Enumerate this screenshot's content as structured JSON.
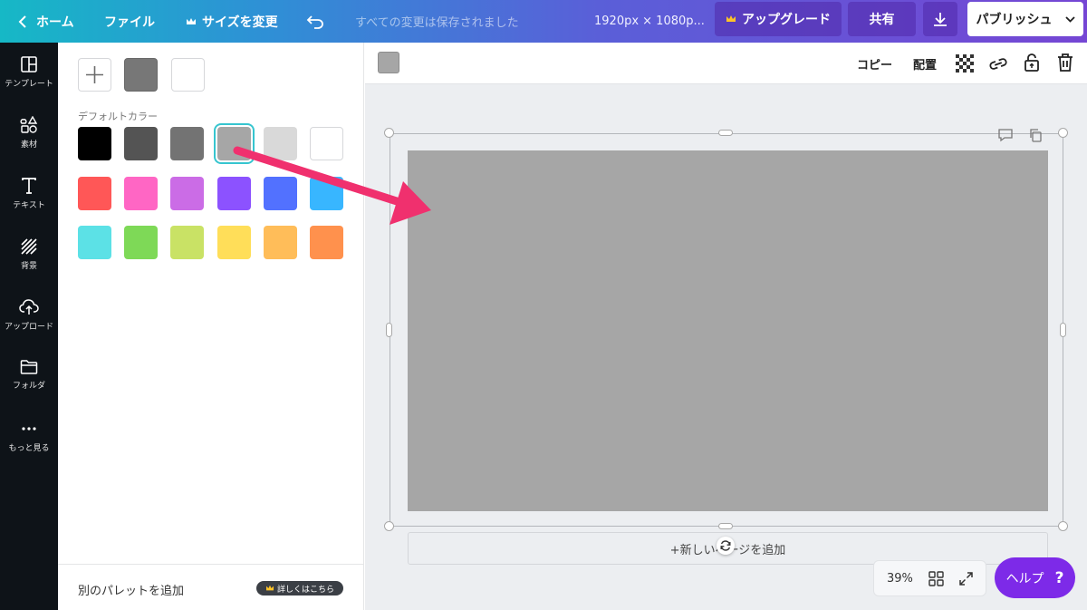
{
  "topbar": {
    "home_label": "ホーム",
    "file_label": "ファイル",
    "resize_label": "サイズを変更",
    "status_text": "すべての変更は保存されました",
    "dimensions_text": "1920px × 1080p...",
    "upgrade_label": "アップグレード",
    "share_label": "共有",
    "publish_label": "パブリッシュ"
  },
  "sidebar": {
    "items": [
      {
        "label": "テンプレート",
        "icon": "template-icon"
      },
      {
        "label": "素材",
        "icon": "elements-icon"
      },
      {
        "label": "テキスト",
        "icon": "text-icon"
      },
      {
        "label": "背景",
        "icon": "background-icon"
      },
      {
        "label": "アップロード",
        "icon": "upload-icon"
      },
      {
        "label": "フォルダ",
        "icon": "folder-icon"
      },
      {
        "label": "もっと見る",
        "icon": "more-icon"
      }
    ]
  },
  "panel": {
    "document_colors": [
      "#777777",
      "#ffffff"
    ],
    "default_colors_title": "デフォルトカラー",
    "default_colors": [
      "#000000",
      "#545454",
      "#737373",
      "#a6a6a6",
      "#d9d9d9",
      "#ffffff",
      "#ff5757",
      "#ff66c4",
      "#cb6ce6",
      "#8c52ff",
      "#5271ff",
      "#38b6ff",
      "#5ce1e6",
      "#7ed957",
      "#c9e265",
      "#ffde59",
      "#ffbd59",
      "#ff914d"
    ],
    "selected_color": "#a6a6a6",
    "add_palette_label": "別のパレットを追加",
    "details_badge": "詳しくはこちら"
  },
  "canvas_toolbar": {
    "current_color": "#a6a6a6",
    "copy_label": "コピー",
    "arrange_label": "配置"
  },
  "canvas": {
    "page_color": "#a6a6a6",
    "add_page_label": "+新しいページを追加",
    "zoom_label": "39%",
    "help_label": "ヘルプ",
    "help_icon": "?"
  },
  "annotation": {
    "arrow_color": "#f0306e"
  }
}
